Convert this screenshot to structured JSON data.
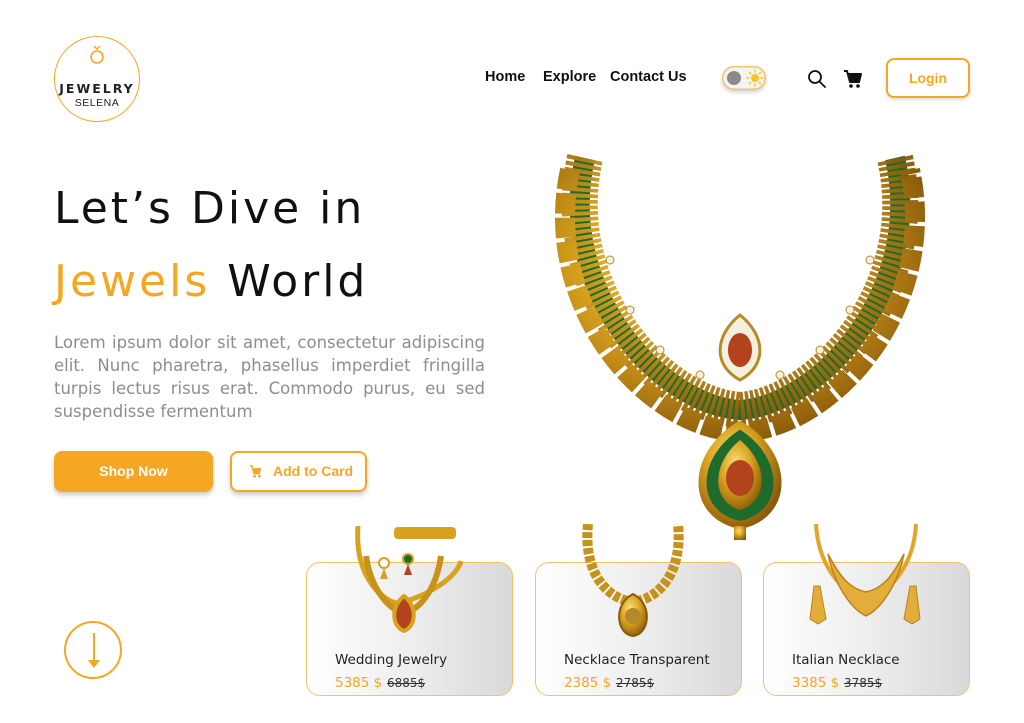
{
  "brand": {
    "name": "JEWELRY",
    "subtitle": "SELENA",
    "logo_icon": "ring-icon"
  },
  "nav": {
    "items": [
      "Home",
      "Explore",
      "Contact Us"
    ]
  },
  "header": {
    "theme_toggle": "light",
    "search_icon": "search-icon",
    "cart_icon": "cart-icon",
    "login_label": "Login"
  },
  "hero": {
    "title_line1": "Let’s Dive in",
    "title_accent": "Jewels",
    "title_rest": "World",
    "description": "Lorem ipsum dolor sit amet, consectetur adipiscing elit. Nunc pharetra, phasellus imperdiet fringilla turpis lectus risus erat. Commodo purus, eu sed suspendisse fermentum",
    "shop_label": "Shop Now",
    "add_to_cart_label": "Add to Card"
  },
  "products": [
    {
      "name": "Wedding Jewelry",
      "price": "5385 $",
      "old_price": "6885$"
    },
    {
      "name": "Necklace Transparent",
      "price": "2385 $",
      "old_price": "2785$"
    },
    {
      "name": "Italian Necklace",
      "price": "3385 $",
      "old_price": "3785$"
    }
  ],
  "colors": {
    "accent": "#f5a623",
    "text": "#111111",
    "muted": "#8d8d8d"
  },
  "scroll_icon": "arrow-down-icon"
}
